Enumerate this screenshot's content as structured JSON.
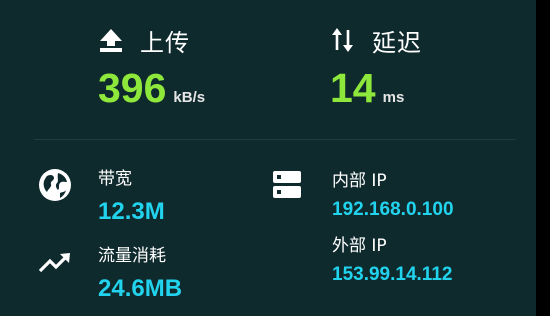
{
  "upload": {
    "icon": "upload-icon",
    "label": "上传",
    "value": "396",
    "unit": "kB/s"
  },
  "latency": {
    "icon": "swap-arrows-icon",
    "label": "延迟",
    "value": "14",
    "unit": "ms"
  },
  "bandwidth": {
    "icon": "globe-icon",
    "label": "带宽",
    "value": "12.3M"
  },
  "traffic": {
    "icon": "trending-up-icon",
    "label": "流量消耗",
    "value": "24.6MB"
  },
  "internal_ip": {
    "icon": "server-icon",
    "label": "内部 IP",
    "value": "192.168.0.100"
  },
  "external_ip": {
    "label": "外部 IP",
    "value": "153.99.14.112"
  },
  "colors": {
    "background": "#0f2a2d",
    "primary_value": "#8ee83c",
    "secondary_value": "#22d3ee"
  }
}
